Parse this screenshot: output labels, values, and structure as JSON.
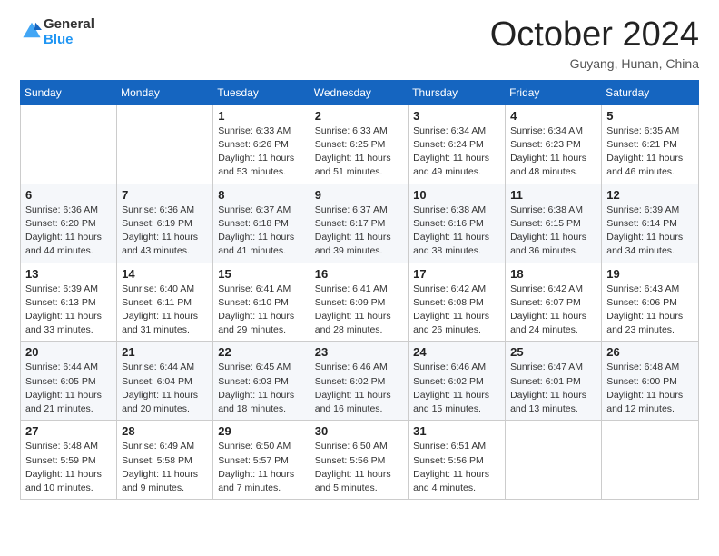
{
  "header": {
    "logo_general": "General",
    "logo_blue": "Blue",
    "month": "October 2024",
    "location": "Guyang, Hunan, China"
  },
  "weekdays": [
    "Sunday",
    "Monday",
    "Tuesday",
    "Wednesday",
    "Thursday",
    "Friday",
    "Saturday"
  ],
  "weeks": [
    [
      {
        "day": "",
        "info": ""
      },
      {
        "day": "",
        "info": ""
      },
      {
        "day": "1",
        "info": "Sunrise: 6:33 AM\nSunset: 6:26 PM\nDaylight: 11 hours and 53 minutes."
      },
      {
        "day": "2",
        "info": "Sunrise: 6:33 AM\nSunset: 6:25 PM\nDaylight: 11 hours and 51 minutes."
      },
      {
        "day": "3",
        "info": "Sunrise: 6:34 AM\nSunset: 6:24 PM\nDaylight: 11 hours and 49 minutes."
      },
      {
        "day": "4",
        "info": "Sunrise: 6:34 AM\nSunset: 6:23 PM\nDaylight: 11 hours and 48 minutes."
      },
      {
        "day": "5",
        "info": "Sunrise: 6:35 AM\nSunset: 6:21 PM\nDaylight: 11 hours and 46 minutes."
      }
    ],
    [
      {
        "day": "6",
        "info": "Sunrise: 6:36 AM\nSunset: 6:20 PM\nDaylight: 11 hours and 44 minutes."
      },
      {
        "day": "7",
        "info": "Sunrise: 6:36 AM\nSunset: 6:19 PM\nDaylight: 11 hours and 43 minutes."
      },
      {
        "day": "8",
        "info": "Sunrise: 6:37 AM\nSunset: 6:18 PM\nDaylight: 11 hours and 41 minutes."
      },
      {
        "day": "9",
        "info": "Sunrise: 6:37 AM\nSunset: 6:17 PM\nDaylight: 11 hours and 39 minutes."
      },
      {
        "day": "10",
        "info": "Sunrise: 6:38 AM\nSunset: 6:16 PM\nDaylight: 11 hours and 38 minutes."
      },
      {
        "day": "11",
        "info": "Sunrise: 6:38 AM\nSunset: 6:15 PM\nDaylight: 11 hours and 36 minutes."
      },
      {
        "day": "12",
        "info": "Sunrise: 6:39 AM\nSunset: 6:14 PM\nDaylight: 11 hours and 34 minutes."
      }
    ],
    [
      {
        "day": "13",
        "info": "Sunrise: 6:39 AM\nSunset: 6:13 PM\nDaylight: 11 hours and 33 minutes."
      },
      {
        "day": "14",
        "info": "Sunrise: 6:40 AM\nSunset: 6:11 PM\nDaylight: 11 hours and 31 minutes."
      },
      {
        "day": "15",
        "info": "Sunrise: 6:41 AM\nSunset: 6:10 PM\nDaylight: 11 hours and 29 minutes."
      },
      {
        "day": "16",
        "info": "Sunrise: 6:41 AM\nSunset: 6:09 PM\nDaylight: 11 hours and 28 minutes."
      },
      {
        "day": "17",
        "info": "Sunrise: 6:42 AM\nSunset: 6:08 PM\nDaylight: 11 hours and 26 minutes."
      },
      {
        "day": "18",
        "info": "Sunrise: 6:42 AM\nSunset: 6:07 PM\nDaylight: 11 hours and 24 minutes."
      },
      {
        "day": "19",
        "info": "Sunrise: 6:43 AM\nSunset: 6:06 PM\nDaylight: 11 hours and 23 minutes."
      }
    ],
    [
      {
        "day": "20",
        "info": "Sunrise: 6:44 AM\nSunset: 6:05 PM\nDaylight: 11 hours and 21 minutes."
      },
      {
        "day": "21",
        "info": "Sunrise: 6:44 AM\nSunset: 6:04 PM\nDaylight: 11 hours and 20 minutes."
      },
      {
        "day": "22",
        "info": "Sunrise: 6:45 AM\nSunset: 6:03 PM\nDaylight: 11 hours and 18 minutes."
      },
      {
        "day": "23",
        "info": "Sunrise: 6:46 AM\nSunset: 6:02 PM\nDaylight: 11 hours and 16 minutes."
      },
      {
        "day": "24",
        "info": "Sunrise: 6:46 AM\nSunset: 6:02 PM\nDaylight: 11 hours and 15 minutes."
      },
      {
        "day": "25",
        "info": "Sunrise: 6:47 AM\nSunset: 6:01 PM\nDaylight: 11 hours and 13 minutes."
      },
      {
        "day": "26",
        "info": "Sunrise: 6:48 AM\nSunset: 6:00 PM\nDaylight: 11 hours and 12 minutes."
      }
    ],
    [
      {
        "day": "27",
        "info": "Sunrise: 6:48 AM\nSunset: 5:59 PM\nDaylight: 11 hours and 10 minutes."
      },
      {
        "day": "28",
        "info": "Sunrise: 6:49 AM\nSunset: 5:58 PM\nDaylight: 11 hours and 9 minutes."
      },
      {
        "day": "29",
        "info": "Sunrise: 6:50 AM\nSunset: 5:57 PM\nDaylight: 11 hours and 7 minutes."
      },
      {
        "day": "30",
        "info": "Sunrise: 6:50 AM\nSunset: 5:56 PM\nDaylight: 11 hours and 5 minutes."
      },
      {
        "day": "31",
        "info": "Sunrise: 6:51 AM\nSunset: 5:56 PM\nDaylight: 11 hours and 4 minutes."
      },
      {
        "day": "",
        "info": ""
      },
      {
        "day": "",
        "info": ""
      }
    ]
  ]
}
